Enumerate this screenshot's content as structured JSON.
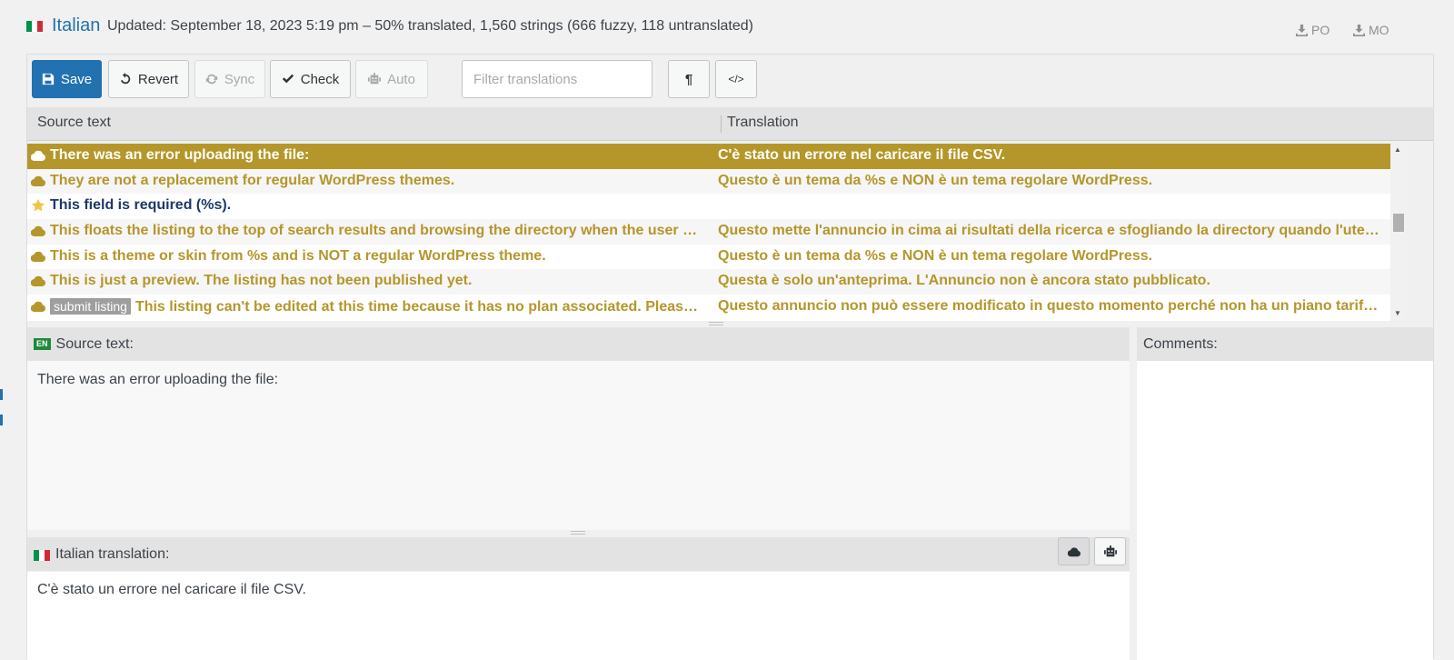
{
  "header": {
    "language": "Italian",
    "updated": "Updated: September 18, 2023 5:19 pm – 50% translated, 1,560 strings (666 fuzzy, 118 untranslated)",
    "downloads": [
      {
        "label": "PO",
        "icon": "download-icon"
      },
      {
        "label": "MO",
        "icon": "download-icon"
      }
    ]
  },
  "toolbar": {
    "save": "Save",
    "revert": "Revert",
    "sync": "Sync",
    "check": "Check",
    "auto": "Auto",
    "filter_placeholder": "Filter translations",
    "invisibles_label": "¶",
    "code_label": "</>"
  },
  "list": {
    "col_source": "Source text",
    "col_translation": "Translation",
    "rows": [
      {
        "icon": "cloud-icon",
        "tag": "",
        "source": "There was an error uploading the file:",
        "translation": "C'è stato un errore nel caricare il file CSV.",
        "state": "selected"
      },
      {
        "icon": "cloud-icon",
        "tag": "",
        "source": "They are not a replacement for regular WordPress themes.",
        "translation": "Questo è un tema da %s e NON è un tema regolare WordPress.",
        "state": "fuzzy"
      },
      {
        "icon": "star-icon",
        "tag": "",
        "source": "This field is required (%s).",
        "translation": "",
        "state": "untranslated"
      },
      {
        "icon": "cloud-icon",
        "tag": "",
        "source": "This floats the listing to the top of search results and browsing the directory when the user b…",
        "translation": "Questo mette l'annuncio in cima ai risultati della ricerca e sfogliando la directory quando l'ute…",
        "state": "fuzzy"
      },
      {
        "icon": "cloud-icon",
        "tag": "",
        "source": "This is a theme or skin from %s and is NOT a regular WordPress theme.",
        "translation": "Questo è un tema da %s e NON è un tema regolare WordPress.",
        "state": "fuzzy"
      },
      {
        "icon": "cloud-icon",
        "tag": "",
        "source": "This is just a preview. The listing has not been published yet.",
        "translation": "Questa è solo un'anteprima. L'Annuncio non è ancora stato pubblicato.",
        "state": "fuzzy"
      },
      {
        "icon": "cloud-icon",
        "tag": "submit listing",
        "source": "This listing can't be edited at this time because it has no plan associated. Please …",
        "translation": "Questo annuncio non può essere modificato in questo momento perché non ha un piano tariff…",
        "state": "fuzzy"
      }
    ]
  },
  "source_pane": {
    "badge": "EN",
    "title": "Source text:",
    "text": "There was an error uploading the file:"
  },
  "comments_pane": {
    "title": "Comments:"
  },
  "translation_pane": {
    "title": "Italian translation:",
    "text": "C'è stato un errore nel caricare il file CSV."
  },
  "colors": {
    "accent": "#2271b1",
    "fuzzy": "#b5962a",
    "untranslated": "#1d3868",
    "badge_en": "#1e8a3a"
  }
}
